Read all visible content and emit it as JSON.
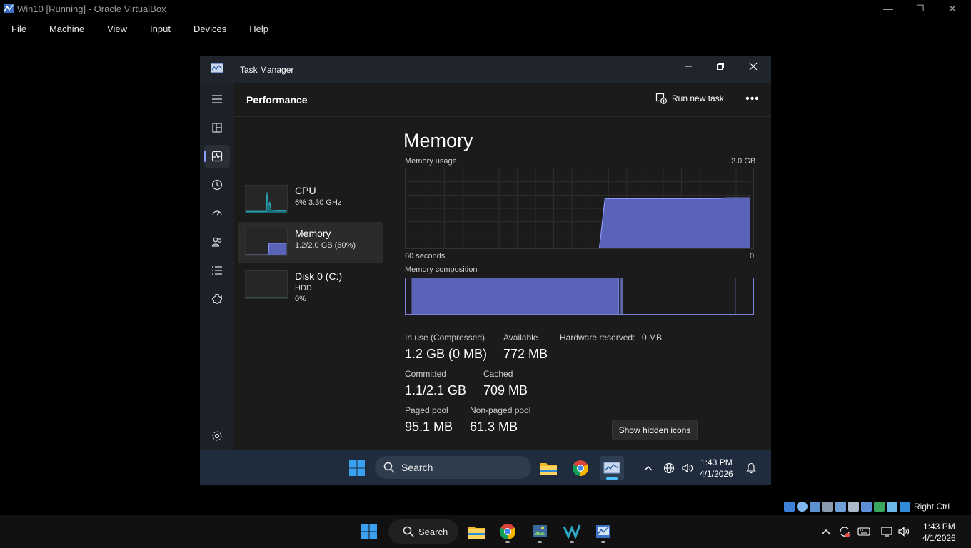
{
  "host_window": {
    "title": "Win10 [Running] - Oracle VirtualBox",
    "menu": [
      "File",
      "Machine",
      "View",
      "Input",
      "Devices",
      "Help"
    ],
    "controls": {
      "minimize": "—",
      "maximize": "❐",
      "close": "✕"
    }
  },
  "task_manager": {
    "title": "Task Manager",
    "header": {
      "page_title": "Performance",
      "run_new_task": "Run new task",
      "more": "•••"
    },
    "nav_icons": [
      "hamburger-menu-icon",
      "processes-icon",
      "performance-icon",
      "app-history-icon",
      "startup-apps-icon",
      "users-icon",
      "details-icon",
      "services-icon",
      "settings-icon"
    ],
    "resources": [
      {
        "name": "CPU",
        "line1": "6%  3.30 GHz",
        "line2": ""
      },
      {
        "name": "Memory",
        "line1": "1.2/2.0 GB (60%)",
        "line2": ""
      },
      {
        "name": "Disk 0 (C:)",
        "line1": "HDD",
        "line2": "0%"
      }
    ],
    "memory": {
      "title": "Memory",
      "usage_label": "Memory usage",
      "usage_max": "2.0 GB",
      "time_left": "60 seconds",
      "time_right": "0",
      "composition_label": "Memory composition",
      "stats": {
        "in_use_label": "In use (Compressed)",
        "in_use_value": "1.2 GB (0 MB)",
        "available_label": "Available",
        "available_value": "772 MB",
        "hw_reserved_label": "Hardware reserved:",
        "hw_reserved_value": "0 MB",
        "committed_label": "Committed",
        "committed_value": "1.1/2.1 GB",
        "cached_label": "Cached",
        "cached_value": "709 MB",
        "paged_pool_label": "Paged pool",
        "paged_pool_value": "95.1 MB",
        "nonpaged_pool_label": "Non-paged pool",
        "nonpaged_pool_value": "61.3 MB"
      }
    },
    "accent_color": "#8e9bff",
    "graph_fill_color": "#5a63b8"
  },
  "tooltip": "Show hidden icons",
  "guest_taskbar": {
    "search_placeholder": "Search",
    "time": "1:43 PM",
    "date": "4/1/2026"
  },
  "host_taskbar": {
    "search_placeholder": "Search",
    "time": "1:43 PM",
    "date": "4/1/2026",
    "host_key": "Right Ctrl"
  }
}
